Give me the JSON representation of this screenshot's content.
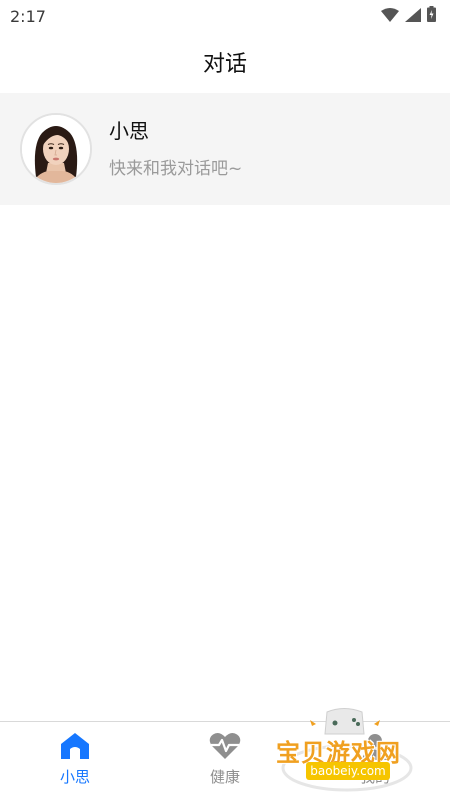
{
  "status_bar": {
    "time": "2:17",
    "icons": [
      "wifi-icon",
      "signal-icon",
      "battery-icon"
    ]
  },
  "header": {
    "title": "对话"
  },
  "conversations": [
    {
      "name": "小思",
      "preview": "快来和我对话吧~",
      "avatar": "avatar-woman"
    }
  ],
  "bottom_nav": {
    "items": [
      {
        "label": "小思",
        "icon": "home-icon",
        "active": true
      },
      {
        "label": "健康",
        "icon": "heart-pulse-icon",
        "active": false
      },
      {
        "label": "我的",
        "icon": "profile-icon",
        "active": false
      }
    ]
  },
  "watermark": {
    "text": "宝贝游戏网",
    "url": "baobeiy.com"
  },
  "colors": {
    "accent": "#1677ff",
    "inactive": "#8f8f8f",
    "item_bg": "#f5f5f5",
    "watermark": "#f0a020"
  }
}
